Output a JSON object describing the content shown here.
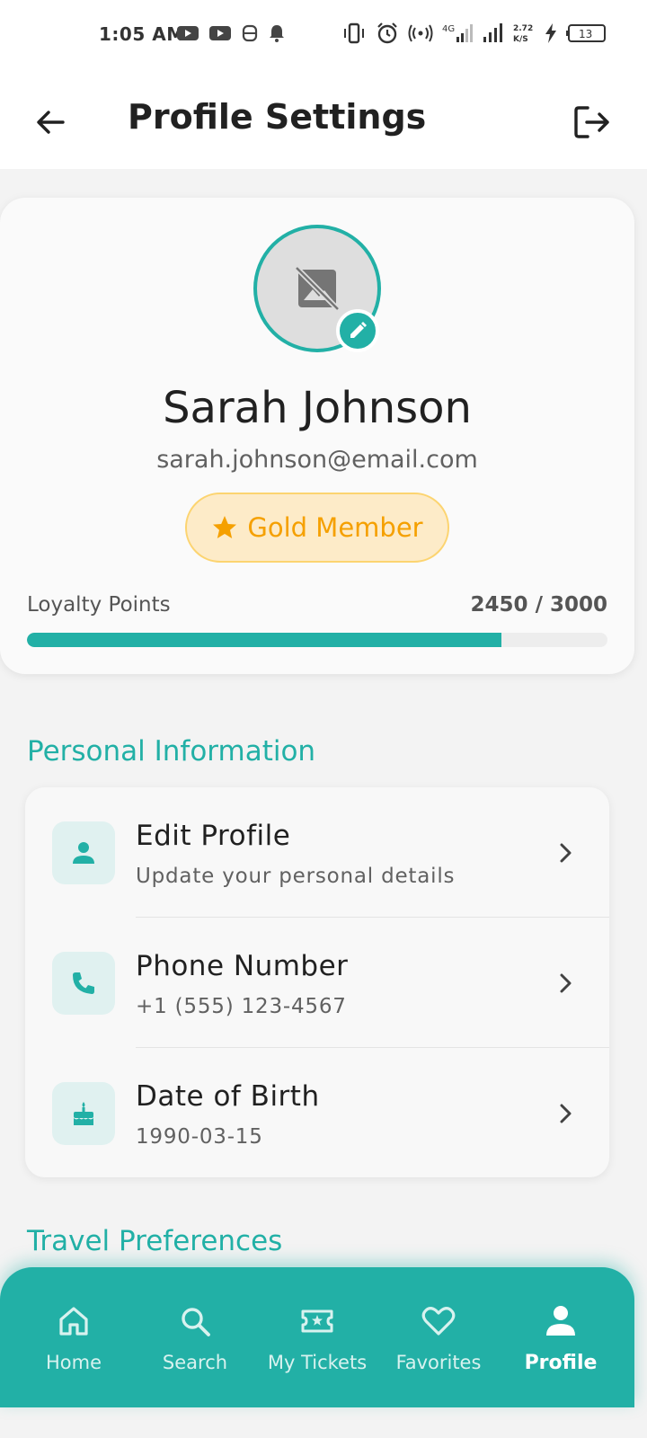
{
  "status_bar": {
    "time": "1:05 AM",
    "network": "4G",
    "speed": "2.72 K/S",
    "battery": "13"
  },
  "app_bar": {
    "title": "Profile Settings",
    "back_icon": "arrow-back-icon",
    "logout_icon": "logout-icon"
  },
  "profile": {
    "name": "Sarah Johnson",
    "email": "sarah.johnson@email.com",
    "badge": "Gold Member",
    "loyalty_label": "Loyalty Points",
    "loyalty_value": "2450 / 3000",
    "loyalty_points": 2450,
    "loyalty_target": 3000
  },
  "sections": {
    "personal": "Personal Information",
    "travel": "Travel Preferences"
  },
  "personal_items": [
    {
      "title": "Edit Profile",
      "subtitle": "Update your personal details",
      "icon": "person-icon"
    },
    {
      "title": "Phone Number",
      "subtitle": "+1 (555) 123-4567",
      "icon": "phone-icon"
    },
    {
      "title": "Date of Birth",
      "subtitle": "1990-03-15",
      "icon": "cake-icon"
    }
  ],
  "nav": {
    "home": "Home",
    "search": "Search",
    "tickets": "My Tickets",
    "favorites": "Favorites",
    "profile": "Profile",
    "active": "profile"
  },
  "colors": {
    "accent": "#22b0a6",
    "gold": "#f5a000",
    "gold_bg": "#fdebc8"
  }
}
